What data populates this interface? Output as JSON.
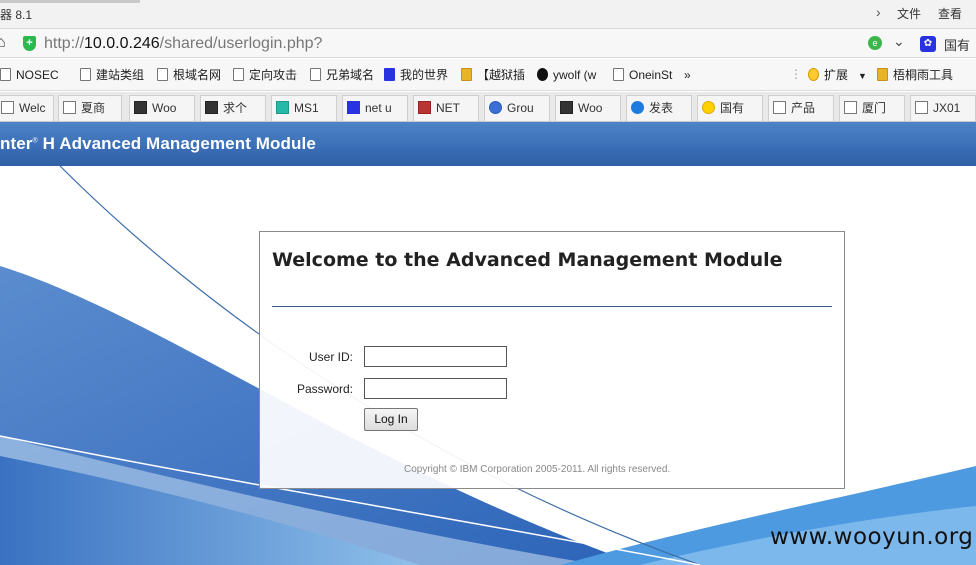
{
  "window": {
    "title_fragment": "器 8.1",
    "menu": [
      "文件",
      "查看"
    ]
  },
  "address": {
    "url_prefix": "http://",
    "url_host": "10.0.0.246",
    "url_path": "/shared/userlogin.php?",
    "search_engine_label": "国有"
  },
  "bookmarks": [
    {
      "label": "NOSEC",
      "icon": "page-icon"
    },
    {
      "label": "建站类组",
      "icon": "page-icon"
    },
    {
      "label": "根域名网",
      "icon": "page-icon"
    },
    {
      "label": "定向攻击",
      "icon": "page-icon"
    },
    {
      "label": "兄弟域名",
      "icon": "page-icon"
    },
    {
      "label": "我的世界",
      "icon": "baidu-icon"
    },
    {
      "label": "【越狱插",
      "icon": "puzzle-icon"
    },
    {
      "label": "ywolf (w",
      "icon": "github-icon"
    },
    {
      "label": "OneinSt",
      "icon": "page-icon"
    },
    {
      "label": "»",
      "icon": ""
    }
  ],
  "bookmarks_right": [
    {
      "label": "扩展",
      "icon": "extensions-icon"
    },
    {
      "label": "梧桐雨工具",
      "icon": "tool-icon"
    }
  ],
  "tabs": [
    {
      "label": "Welc",
      "icon": "page-icon"
    },
    {
      "label": "夏商",
      "icon": "page-icon"
    },
    {
      "label": "Woo",
      "icon": "wooyun-icon"
    },
    {
      "label": "求个",
      "icon": "wooyun-icon"
    },
    {
      "label": "MS1",
      "icon": "ms-icon"
    },
    {
      "label": "net u",
      "icon": "baidu-icon"
    },
    {
      "label": "NET",
      "icon": "b-icon"
    },
    {
      "label": "Grou",
      "icon": "cloud-icon"
    },
    {
      "label": "Woo",
      "icon": "wooyun-icon"
    },
    {
      "label": "发表",
      "icon": "s-icon"
    },
    {
      "label": "国有",
      "icon": "flag-icon"
    },
    {
      "label": "产品",
      "icon": "page-icon"
    },
    {
      "label": "厦门",
      "icon": "page-icon"
    },
    {
      "label": "JX01",
      "icon": "page-icon"
    }
  ],
  "header": {
    "app_title_prefix": "nter",
    "app_title_reg": "®",
    "app_title_rest": " H Advanced Management Module"
  },
  "login": {
    "title": "Welcome to the Advanced Management Module",
    "userid_label": "User ID:",
    "userid_value": "",
    "password_label": "Password:",
    "password_value": "",
    "login_button": "Log In",
    "copyright": "Copyright © IBM Corporation 2005-2011. All rights reserved."
  },
  "watermark": "www.wooyun.org"
}
